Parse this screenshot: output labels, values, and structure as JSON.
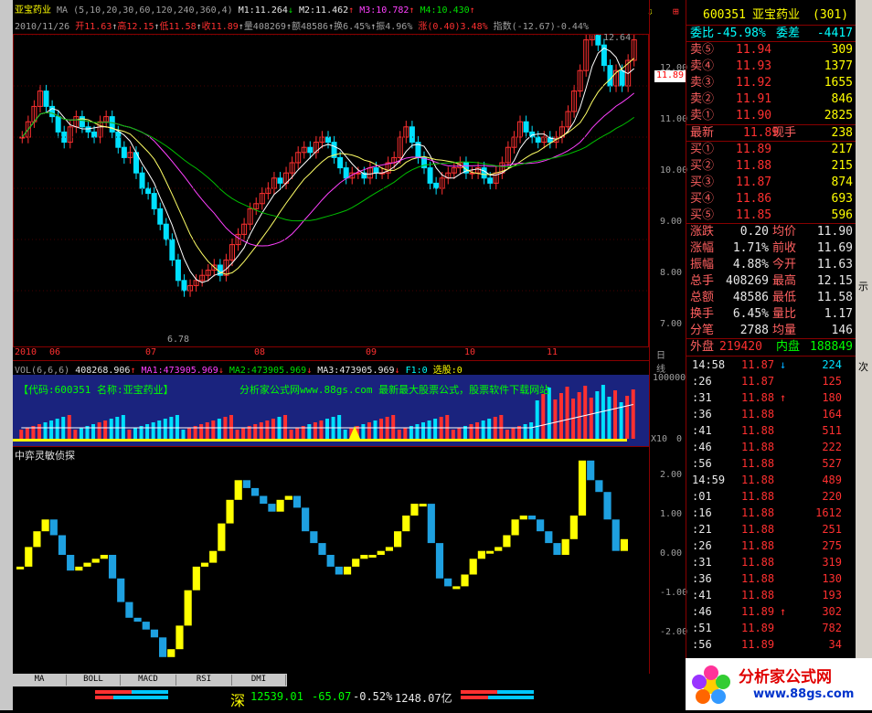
{
  "stock": {
    "name": "亚宝药业",
    "ma_params": "MA (5,10,20,30,60,120,240,360,4)",
    "m1": "M1:11.264",
    "m2": "M2:11.462",
    "m3": "M3:10.782",
    "m4": "M4:10.430",
    "date": "2010/11/26",
    "open": "开11.63",
    "high": "高12.15",
    "low": "低11.58",
    "close": "收11.89",
    "vol": "量408269",
    "amount": "额48586",
    "turnover": "换6.45%",
    "swing": "振4.96%",
    "change": "涨(0.40)3.48%",
    "index": "指数(-12.67)-0.44%"
  },
  "kchart": {
    "peak_label": "12.64",
    "low_label": "6.78",
    "price_tag": "11.89",
    "yaxis": [
      "12.00",
      "11.00",
      "10.00",
      "9.00",
      "8.00",
      "7.00"
    ],
    "dates": [
      "2010",
      "06",
      "07",
      "08",
      "09",
      "10",
      "11"
    ],
    "period": "日线"
  },
  "vol": {
    "params": "VOL(6,6,6)",
    "value": "408268.906",
    "ma1": "MA1:473905.969",
    "ma2": "MA2:473905.969",
    "ma3": "MA3:473905.969",
    "f1": "F1:0",
    "pick": "选股:0",
    "ad_code": "【代码:600351 名称:亚宝药业】",
    "ad_site": "分析家公式网www.88gs.com 最新最大股票公式，股票软件下载网站",
    "yaxis_top": "100000",
    "yaxis_unit": "X10",
    "yaxis_zero": "0"
  },
  "osc": {
    "title": "中弈灵敏侦探",
    "yaxis": [
      "2.00",
      "1.00",
      "0.00",
      "-1.00",
      "-2.00"
    ]
  },
  "tabs": [
    "MA",
    "BOLL",
    "MACD",
    "RSI",
    "DMI"
  ],
  "status": {
    "market": "深",
    "index": "12539.01",
    "change": "-65.07",
    "pct": "-0.52%",
    "amount": "1248.07亿"
  },
  "quote": {
    "code": "600351",
    "name": "亚宝药业",
    "num": "(301)",
    "wb_label": "委比",
    "wb": "-45.98%",
    "wc_label": "委差",
    "wc": "-4417",
    "asks": [
      {
        "l": "卖⑤",
        "p": "11.94",
        "v": "309"
      },
      {
        "l": "卖④",
        "p": "11.93",
        "v": "1377"
      },
      {
        "l": "卖③",
        "p": "11.92",
        "v": "1655"
      },
      {
        "l": "卖②",
        "p": "11.91",
        "v": "846"
      },
      {
        "l": "卖①",
        "p": "11.90",
        "v": "2825"
      }
    ],
    "last_label": "最新",
    "last": "11.89",
    "now_label": "现手",
    "now": "238",
    "bids": [
      {
        "l": "买①",
        "p": "11.89",
        "v": "217"
      },
      {
        "l": "买②",
        "p": "11.88",
        "v": "215"
      },
      {
        "l": "买③",
        "p": "11.87",
        "v": "874"
      },
      {
        "l": "买④",
        "p": "11.86",
        "v": "693"
      },
      {
        "l": "买⑤",
        "p": "11.85",
        "v": "596"
      }
    ],
    "stats": [
      {
        "a": "涨跌",
        "av": "0.20",
        "b": "均价",
        "bv": "11.90"
      },
      {
        "a": "涨幅",
        "av": "1.71%",
        "b": "前收",
        "bv": "11.69"
      },
      {
        "a": "振幅",
        "av": "4.88%",
        "b": "今开",
        "bv": "11.63"
      },
      {
        "a": "总手",
        "av": "408269",
        "b": "最高",
        "bv": "12.15"
      },
      {
        "a": "总额",
        "av": "48586",
        "b": "最低",
        "bv": "11.58"
      },
      {
        "a": "换手",
        "av": "6.45%",
        "b": "量比",
        "bv": "1.17"
      },
      {
        "a": "分笔",
        "av": "2788",
        "b": "均量",
        "bv": "146"
      }
    ],
    "outer_label": "外盘",
    "outer": "219420",
    "inner_label": "内盘",
    "inner": "188849",
    "ticks": [
      {
        "t": "14:58",
        "p": "11.87",
        "a": "↓",
        "v": "224"
      },
      {
        "t": ":26",
        "p": "11.87",
        "a": "",
        "v": "125"
      },
      {
        "t": ":31",
        "p": "11.88",
        "a": "↑",
        "v": "180"
      },
      {
        "t": ":36",
        "p": "11.88",
        "a": "",
        "v": "164"
      },
      {
        "t": ":41",
        "p": "11.88",
        "a": "",
        "v": "511"
      },
      {
        "t": ":46",
        "p": "11.88",
        "a": "",
        "v": "222"
      },
      {
        "t": ":56",
        "p": "11.88",
        "a": "",
        "v": "527"
      },
      {
        "t": "14:59",
        "p": "11.88",
        "a": "",
        "v": "489"
      },
      {
        "t": ":01",
        "p": "11.88",
        "a": "",
        "v": "220"
      },
      {
        "t": ":16",
        "p": "11.88",
        "a": "",
        "v": "1612"
      },
      {
        "t": ":21",
        "p": "11.88",
        "a": "",
        "v": "251"
      },
      {
        "t": ":26",
        "p": "11.88",
        "a": "",
        "v": "275"
      },
      {
        "t": ":31",
        "p": "11.88",
        "a": "",
        "v": "319"
      },
      {
        "t": ":36",
        "p": "11.88",
        "a": "",
        "v": "130"
      },
      {
        "t": ":41",
        "p": "11.88",
        "a": "",
        "v": "193"
      },
      {
        "t": ":46",
        "p": "11.89",
        "a": "↑",
        "v": "302"
      },
      {
        "t": ":51",
        "p": "11.89",
        "a": "",
        "v": "782"
      },
      {
        "t": ":56",
        "p": "11.89",
        "a": "",
        "v": "34"
      }
    ]
  },
  "logo": {
    "text": "分析家公式网",
    "url": "www.88gs.com"
  },
  "scroll_labels": [
    "示",
    "次"
  ]
}
